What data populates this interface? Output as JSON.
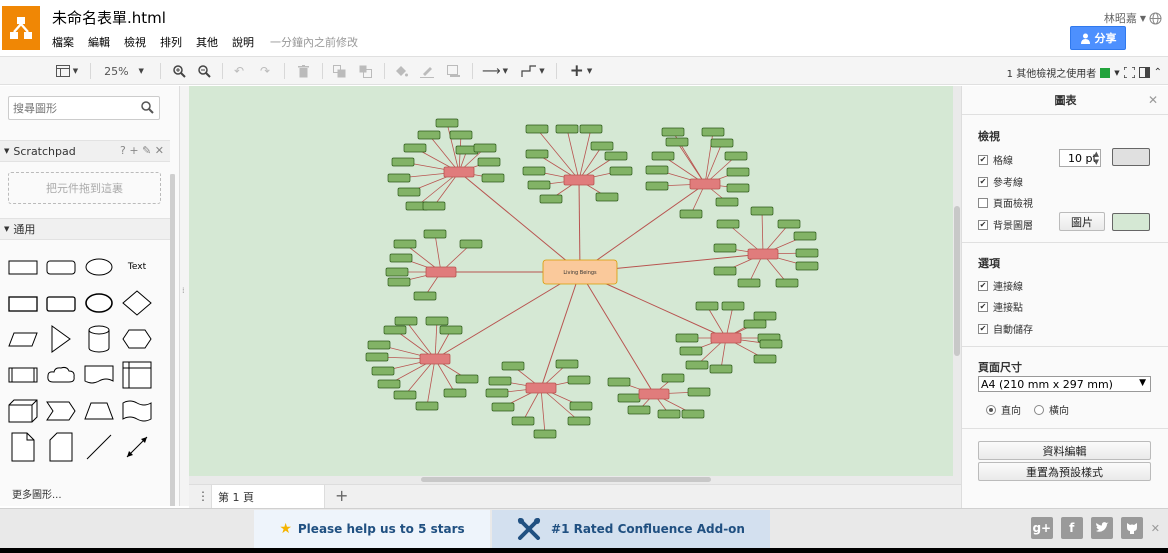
{
  "app": {
    "title": "未命名表單.html",
    "menus": [
      "檔案",
      "編輯",
      "檢視",
      "排列",
      "其他",
      "說明"
    ],
    "last_modified": "一分鐘內之前修改",
    "user_name": "林昭嘉",
    "share_label": "分享",
    "brand_color": "#f08705",
    "share_color": "#4d90fe"
  },
  "toolbar": {
    "zoom": "25%",
    "other_viewers": "1 其他檢視之使用者",
    "viewer_color": "#22a33c"
  },
  "sidebar": {
    "search_placeholder": "搜尋圖形",
    "scratchpad_label": "Scratchpad",
    "scratchpad_tools": "? + ✎ ✕",
    "dropzone_text": "把元件拖到這裏",
    "general_label": "通用",
    "text_shape_label": "Text",
    "more_shapes": "更多圖形..."
  },
  "canvas": {
    "background": "#d5e8d4",
    "center_label": "Living Beings"
  },
  "pages": {
    "tab_label": "第 1 頁"
  },
  "format_panel": {
    "title": "圖表",
    "view_section": "檢視",
    "grid_label": "格線",
    "grid_size": "10 pt",
    "guides_label": "參考線",
    "page_view_label": "頁面檢視",
    "background_label": "背景圖層",
    "image_button": "圖片",
    "options_section": "選項",
    "connection_arrows_label": "連接線",
    "connection_points_label": "連接點",
    "autosave_label": "自動儲存",
    "page_size_section": "頁面尺寸",
    "page_size_value": "A4 (210 mm x 297 mm)",
    "portrait_label": "直向",
    "landscape_label": "橫向",
    "edit_data_button": "資料編輯",
    "reset_style_button": "重置為預設樣式"
  },
  "footer": {
    "stars_text": "Please help us to 5 stars",
    "rated_text": "#1 Rated Confluence Add-on"
  }
}
